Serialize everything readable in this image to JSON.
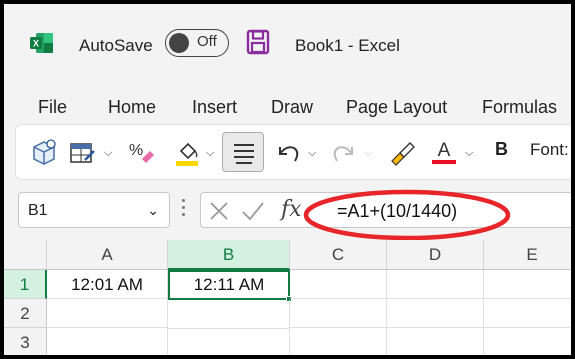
{
  "titlebar": {
    "app_icon": "excel-logo",
    "autosave_label": "AutoSave",
    "autosave_state": "Off",
    "save_icon": "save-icon",
    "doc_title": "Book1  -  Excel"
  },
  "menu": [
    "File",
    "Home",
    "Insert",
    "Draw",
    "Page Layout",
    "Formulas"
  ],
  "ribbon": {
    "icons": [
      "3d-models-icon",
      "format-table-icon",
      "percent-style-icon",
      "fill-color-icon",
      "align-center-icon",
      "undo-icon",
      "redo-icon",
      "format-painter-icon",
      "font-color-icon"
    ],
    "bold_label": "B",
    "font_label": "Font:",
    "fill_color": "#ffd700",
    "font_color": "#e81123"
  },
  "formula_bar": {
    "name_box": "B1",
    "fx_label": "fx",
    "formula": "=A1+(10/1440)",
    "annotation_color": "#e8262a"
  },
  "grid": {
    "columns": [
      "A",
      "B",
      "C",
      "D",
      "E"
    ],
    "rows": [
      "1",
      "2",
      "3"
    ],
    "selected_column": "B",
    "selected_row": "1",
    "cells": {
      "A1": "12:01 AM",
      "B1": "12:11 AM"
    }
  }
}
